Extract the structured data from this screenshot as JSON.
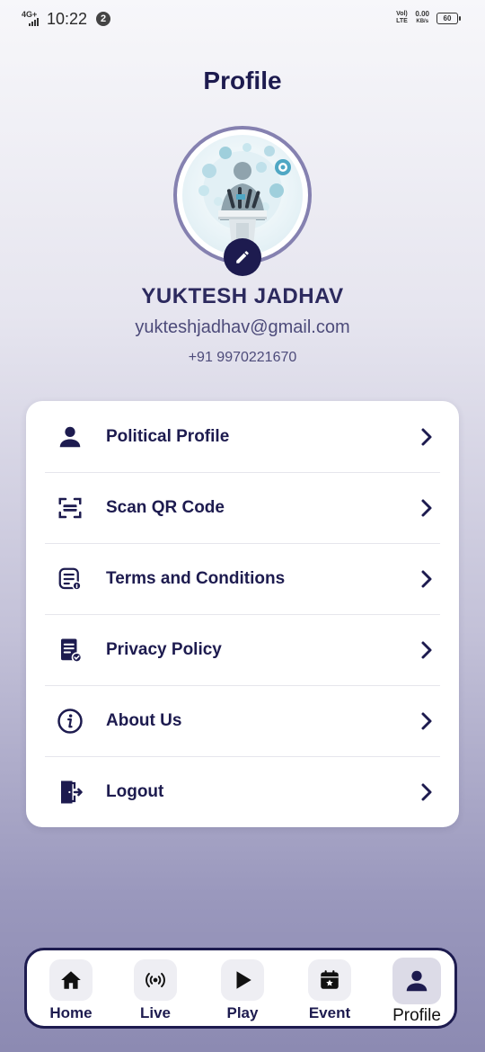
{
  "status_bar": {
    "network": "4G+",
    "time": "10:22",
    "notification_count": "2",
    "volte": "Vol) LTE",
    "data_speed": "0.00",
    "data_unit": "KB/s",
    "battery": "60"
  },
  "header": {
    "title": "Profile"
  },
  "profile": {
    "avatar_icon": "speaker-podium-illustration",
    "edit_icon": "pencil-icon",
    "name": "YUKTESH JADHAV",
    "email": "yukteshjadhav@gmail.com",
    "phone": "+91 9970221670"
  },
  "menu": {
    "items": [
      {
        "label": "Political Profile",
        "icon": "person-icon"
      },
      {
        "label": "Scan QR Code",
        "icon": "scan-icon"
      },
      {
        "label": "Terms and Conditions",
        "icon": "terms-document-icon"
      },
      {
        "label": "Privacy Policy",
        "icon": "policy-document-icon"
      },
      {
        "label": "About Us",
        "icon": "info-icon"
      },
      {
        "label": "Logout",
        "icon": "logout-icon"
      }
    ]
  },
  "bottom_nav": {
    "items": [
      {
        "label": "Home",
        "icon": "home-icon"
      },
      {
        "label": "Live",
        "icon": "broadcast-icon"
      },
      {
        "label": "Play",
        "icon": "play-icon"
      },
      {
        "label": "Event",
        "icon": "calendar-icon"
      },
      {
        "label": "Profile",
        "icon": "person-icon",
        "active": true
      }
    ]
  },
  "colors": {
    "primary": "#1d1b4f",
    "avatar_ring": "#8581b0",
    "card": "#ffffff"
  }
}
